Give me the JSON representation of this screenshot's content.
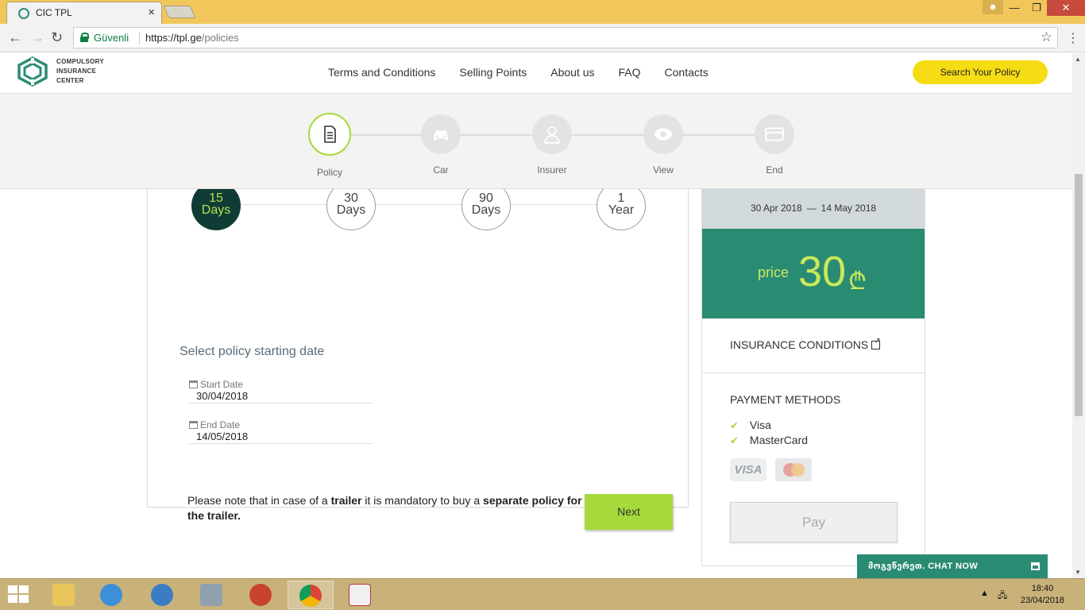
{
  "browser": {
    "tab_title": "CIC TPL",
    "secure_label": "Güvenli",
    "url_scheme_host": "https://tpl.ge",
    "url_path": "/policies"
  },
  "site": {
    "logo_lines": [
      "COMPULSORY",
      "INSURANCE",
      "CENTER"
    ],
    "nav": [
      "Terms and Conditions",
      "Selling Points",
      "About us",
      "FAQ",
      "Contacts"
    ],
    "search_button": "Search Your Policy"
  },
  "stepper": {
    "steps": [
      {
        "label": "Policy",
        "icon": "document-icon",
        "active": true
      },
      {
        "label": "Car",
        "icon": "car-icon",
        "active": false
      },
      {
        "label": "Insurer",
        "icon": "person-icon",
        "active": false
      },
      {
        "label": "View",
        "icon": "eye-icon",
        "active": false
      },
      {
        "label": "End",
        "icon": "card-icon",
        "active": false
      }
    ]
  },
  "durations": [
    {
      "top": "15",
      "bottom": "Days",
      "selected": true
    },
    {
      "top": "30",
      "bottom": "Days",
      "selected": false
    },
    {
      "top": "90",
      "bottom": "Days",
      "selected": false
    },
    {
      "top": "1",
      "bottom": "Year",
      "selected": false
    }
  ],
  "date_section": {
    "heading": "Select policy starting date",
    "start_label": "Start Date",
    "start_value": "30/04/2018",
    "end_label": "End Date",
    "end_value": "14/05/2018"
  },
  "note": {
    "part1": "Please note that in case of a ",
    "bold1": "trailer",
    "part2": " it is mandatory to buy a ",
    "bold2": "separate policy for the trailer."
  },
  "next_button": "Next",
  "summary": {
    "date_from": "30 Apr 2018",
    "date_sep": "—",
    "date_to": "14 May 2018",
    "price_label": "price",
    "price_value": "30",
    "currency_symbol": "₾",
    "conditions_link": "INSURANCE CONDITIONS",
    "payment_heading": "PAYMENT METHODS",
    "payment_methods": [
      "Visa",
      "MasterCard"
    ],
    "visa_logo": "VISA",
    "pay_button": "Pay"
  },
  "chat": {
    "label": "მოგვწერეთ. CHAT NOW"
  },
  "taskbar": {
    "time": "18:40",
    "date": "23/04/2018"
  },
  "colors": {
    "brand_green": "#2a8b73",
    "accent_lime": "#a6d93b",
    "dark_teal": "#0f3c35",
    "yellow": "#f5dc15"
  }
}
